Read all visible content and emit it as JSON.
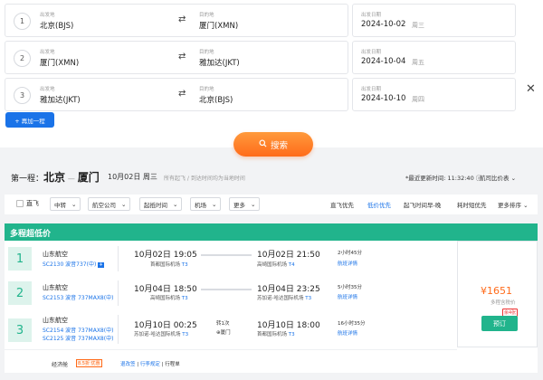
{
  "segments_form": [
    {
      "num": "1",
      "from_label": "出发地",
      "from": "北京(BJS)",
      "to_label": "目的地",
      "to": "厦门(XMN)",
      "date_label": "出发日期",
      "date": "2024-10-02",
      "weekday": "周三"
    },
    {
      "num": "2",
      "from_label": "出发地",
      "from": "厦门(XMN)",
      "to_label": "目的地",
      "to": "雅加达(JKT)",
      "date_label": "出发日期",
      "date": "2024-10-04",
      "weekday": "周五"
    },
    {
      "num": "3",
      "from_label": "出发地",
      "from": "雅加达(JKT)",
      "to_label": "目的地",
      "to": "北京(BJS)",
      "date_label": "出发日期",
      "date": "2024-10-10",
      "weekday": "周四"
    }
  ],
  "add_trip": "+ 再加一程",
  "search": "搜索",
  "header": {
    "trip_label": "第一程：",
    "from": "北京",
    "dash": "—",
    "to": "厦门",
    "date": "10月02日 周三",
    "note": "所有起飞 / 到达时间均为当地时间",
    "updated": "*最近更新时间: 11:32:40",
    "calendar": "航司比价表"
  },
  "filters": {
    "direct": "直飞",
    "dropdowns": [
      "中转",
      "航空公司",
      "起抵时间",
      "机场",
      "更多"
    ],
    "sorts": [
      "直飞优先",
      "低价优先",
      "起飞时间早-晚",
      "耗时短优先",
      "更多排序"
    ]
  },
  "banner": "多程超低价",
  "legs": [
    {
      "num": "1",
      "airline": "山东航空",
      "flight1": "SC2130 波音737(中)",
      "flight2": "",
      "dep": "10月02日 19:05",
      "dep_apt": "首都国际机场",
      "dep_t": "T3",
      "arr": "10月02日 21:50",
      "arr_apt": "高崎国际机场",
      "arr_t": "T4",
      "dur": "2小时45分",
      "detail": "航班详情",
      "stop": "",
      "stop_city": ""
    },
    {
      "num": "2",
      "airline": "山东航空",
      "flight1": "SC2153 波音 737MAX8(中)",
      "flight2": "",
      "dep": "10月04日 18:50",
      "dep_apt": "高崎国际机场",
      "dep_t": "T3",
      "arr": "10月04日 23:25",
      "arr_apt": "苏加诺-哈达国际机场",
      "arr_t": "T3",
      "dur": "5小时35分",
      "detail": "航班详情",
      "stop": "",
      "stop_city": ""
    },
    {
      "num": "3",
      "airline": "山东航空",
      "flight1": "SC2154 波音 737MAX8(中)",
      "flight2": "SC2125 波音 737MAX8(中)",
      "dep": "10月10日 00:25",
      "dep_apt": "苏加诺-哈达国际机场",
      "dep_t": "T3",
      "arr": "10月10日 18:00",
      "arr_apt": "首都国际机场",
      "arr_t": "T3",
      "dur": "16小时35分",
      "detail": "航班详情",
      "stop": "转1次",
      "stop_city": "⊕厦门"
    }
  ],
  "price": {
    "amount": "¥1651",
    "note": "多程含税价",
    "remain": "余4张",
    "book": "预订"
  },
  "footer": {
    "cabin": "经济舱",
    "badge": "8.5折 优惠",
    "links1": "退改签",
    "sep": " | ",
    "links2": "行李规定",
    "links3": "行程单"
  },
  "icons": {
    "swap": "swap-arrows-icon",
    "close": "close-icon",
    "search": "search-icon",
    "chevron": "chevron-down-icon"
  },
  "colors": {
    "accent": "#1a73e8",
    "green": "#21b48c",
    "orange": "#ff6b1a"
  }
}
